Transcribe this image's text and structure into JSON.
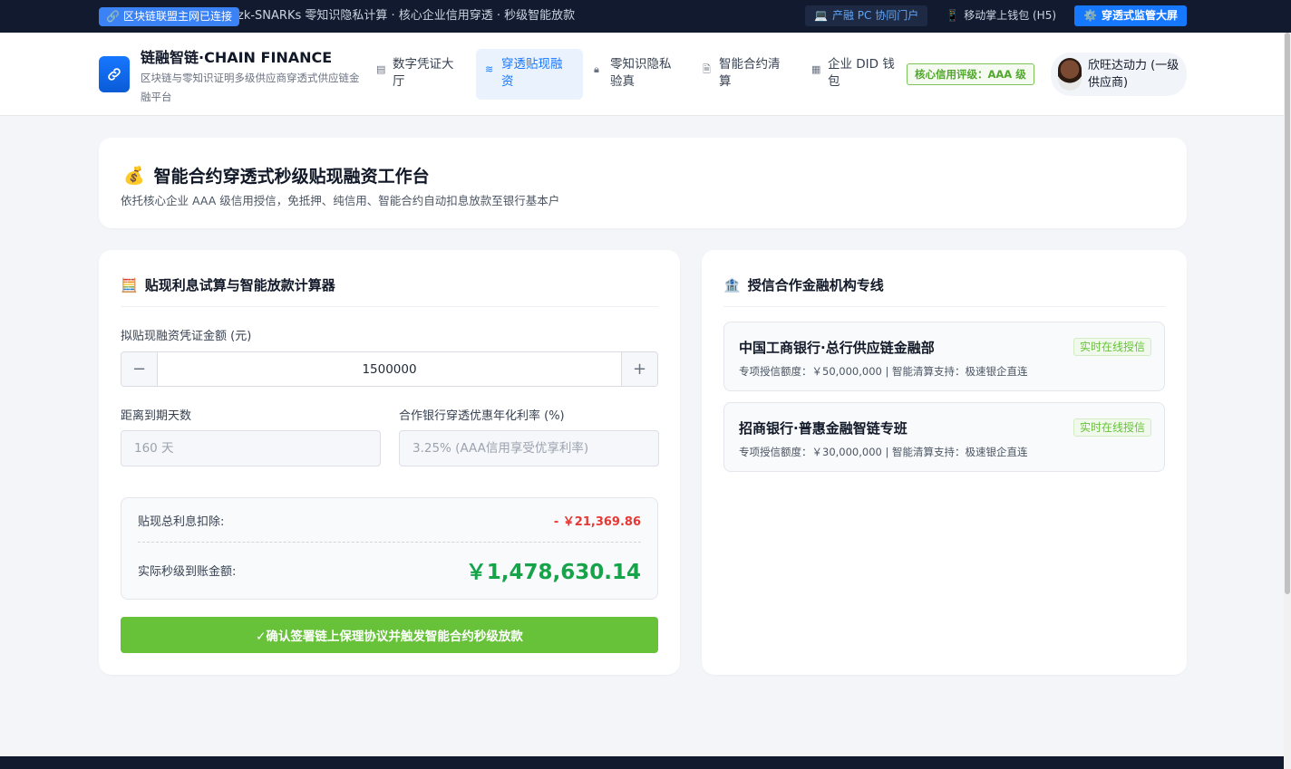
{
  "topbar": {
    "chain_status": "区块链联盟主网已连接",
    "marquee": "zk-SNARKs 零知识隐私计算 · 核心企业信用穿透 · 秒级智能放款",
    "pc_portal": "产融 PC 协同门户",
    "mobile_wallet": "移动掌上钱包 (H5)",
    "supervision_screen": "穿透式监管大屏"
  },
  "brand": {
    "title": "链融智链·CHAIN FINANCE",
    "subtitle": "区块链与零知识证明多级供应商穿透式供应链金融平台"
  },
  "nav": {
    "items": [
      {
        "label": "数字凭证大厅",
        "icon": "document-icon"
      },
      {
        "label": "穿透贴现融资",
        "icon": "database-icon"
      },
      {
        "label": "零知识隐私验真",
        "icon": "lock-icon"
      },
      {
        "label": "智能合约清算",
        "icon": "file-check-icon"
      },
      {
        "label": "企业 DID 钱包",
        "icon": "building-icon"
      }
    ],
    "active_index": 1
  },
  "header": {
    "credit_rating": "核心信用评级：AAA 级",
    "user_name": "欣旺达动力 (一级供应商)"
  },
  "hero": {
    "title": "智能合约穿透式秒级贴现融资工作台",
    "subtitle": "依托核心企业 AAA 级信用授信，免抵押、纯信用、智能合约自动扣息放款至银行基本户"
  },
  "calculator": {
    "title": "贴现利息试算与智能放款计算器",
    "amount_label": "拟贴现融资凭证金额 (元)",
    "amount_value": "1500000",
    "days_label": "距离到期天数",
    "days_value": "160 天",
    "rate_label": "合作银行穿透优惠年化利率 (%)",
    "rate_value": "3.25% (AAA信用享受优享利率)",
    "interest_label": "贴现总利息扣除:",
    "interest_value": "- ￥21,369.86",
    "received_label": "实际秒级到账金额:",
    "received_value": "￥1,478,630.14",
    "confirm_button": "✓确认签署链上保理协议并触发智能合约秒级放款"
  },
  "banks": {
    "title": "授信合作金融机构专线",
    "items": [
      {
        "name": "中国工商银行·总行供应链金融部",
        "tag": "实时在线授信",
        "desc": "专项授信额度：￥50,000,000 | 智能清算支持：极速银企直连"
      },
      {
        "name": "招商银行·普惠金融智链专班",
        "tag": "实时在线授信",
        "desc": "专项授信额度：￥30,000,000 | 智能清算支持：极速银企直连"
      }
    ]
  },
  "colors": {
    "accent": "#1677ff",
    "success": "#67c23a",
    "danger": "#e53935",
    "topbar_bg": "#111a2e"
  }
}
